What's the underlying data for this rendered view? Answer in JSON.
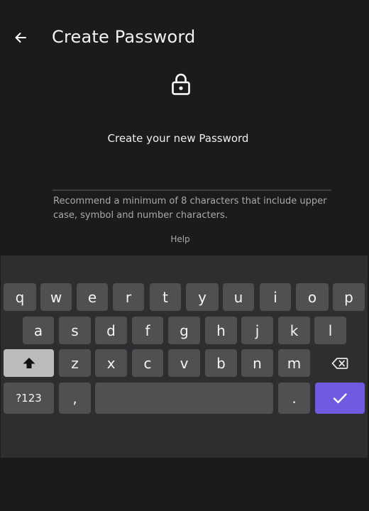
{
  "header": {
    "title": "Create Password"
  },
  "main": {
    "prompt": "Create your new Password",
    "password_value": "",
    "hint": "Recommend a minimum of 8 characters that include upper case, symbol and number characters.",
    "help_label": "Help"
  },
  "keyboard": {
    "row1": [
      "q",
      "w",
      "e",
      "r",
      "t",
      "y",
      "u",
      "i",
      "o",
      "p"
    ],
    "row2": [
      "a",
      "s",
      "d",
      "f",
      "g",
      "h",
      "j",
      "k",
      "l"
    ],
    "row3": [
      "z",
      "x",
      "c",
      "v",
      "b",
      "n",
      "m"
    ],
    "symbols_label": "?123",
    "comma_label": ",",
    "period_label": ".",
    "accent_color": "#6e5be0"
  },
  "icons": {
    "back": "arrow-left-icon",
    "lock": "lock-icon",
    "shift": "shift-icon",
    "backspace": "backspace-icon",
    "enter": "check-icon"
  }
}
